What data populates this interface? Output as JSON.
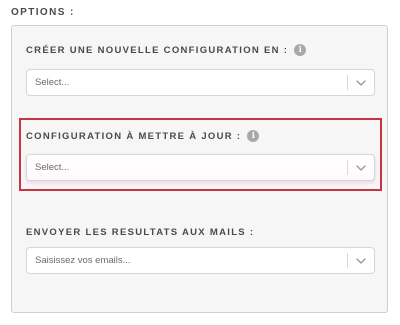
{
  "options": {
    "title": "OPTIONS :"
  },
  "fields": [
    {
      "label": "CRÉER UNE NOUVELLE CONFIGURATION EN :",
      "has_info": true,
      "select_value": "Select...",
      "icon": "chevron-down-icon"
    },
    {
      "label": "CONFIGURATION À METTRE À JOUR :",
      "has_info": true,
      "select_value": "Select...",
      "icon": "chevron-down-icon",
      "highlighted": true
    },
    {
      "label": "ENVOYER LES RESULTATS AUX MAILS :",
      "has_info": false,
      "placeholder": "Saisissez vos emails...",
      "icon": "chevron-down-icon"
    }
  ],
  "info_icon_glyph": "i",
  "colors": {
    "highlight_border": "#c8353f",
    "panel_background": "#f6f6f6",
    "info_icon": "#a8a8a8"
  }
}
